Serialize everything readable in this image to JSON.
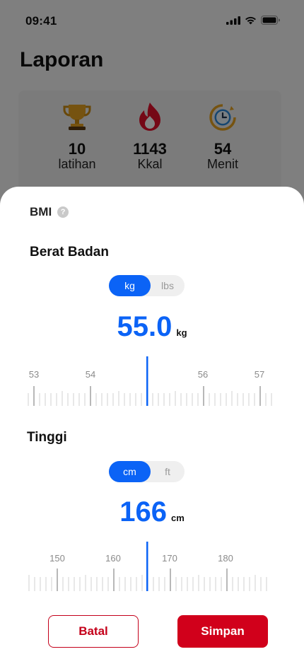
{
  "status": {
    "time": "09:41"
  },
  "header": {
    "title": "Laporan"
  },
  "stats": [
    {
      "icon": "trophy-icon",
      "value": "10",
      "label": "latihan"
    },
    {
      "icon": "fire-icon",
      "value": "1143",
      "label": "Kkal"
    },
    {
      "icon": "timer-icon",
      "value": "54",
      "label": "Menit"
    }
  ],
  "sheet": {
    "bmi_label": "BMI",
    "weight": {
      "title": "Berat Badan",
      "units": [
        "kg",
        "lbs"
      ],
      "selected_unit": "kg",
      "value": "55.0",
      "unit": "kg",
      "ruler_labels": [
        "53",
        "54",
        "56",
        "57"
      ]
    },
    "height": {
      "title": "Tinggi",
      "units": [
        "cm",
        "ft"
      ],
      "selected_unit": "cm",
      "value": "166",
      "unit": "cm",
      "ruler_labels": [
        "150",
        "160",
        "170",
        "180"
      ]
    },
    "cancel_label": "Batal",
    "save_label": "Simpan"
  },
  "colors": {
    "accent": "#0b63f6",
    "danger": "#d1001b"
  }
}
